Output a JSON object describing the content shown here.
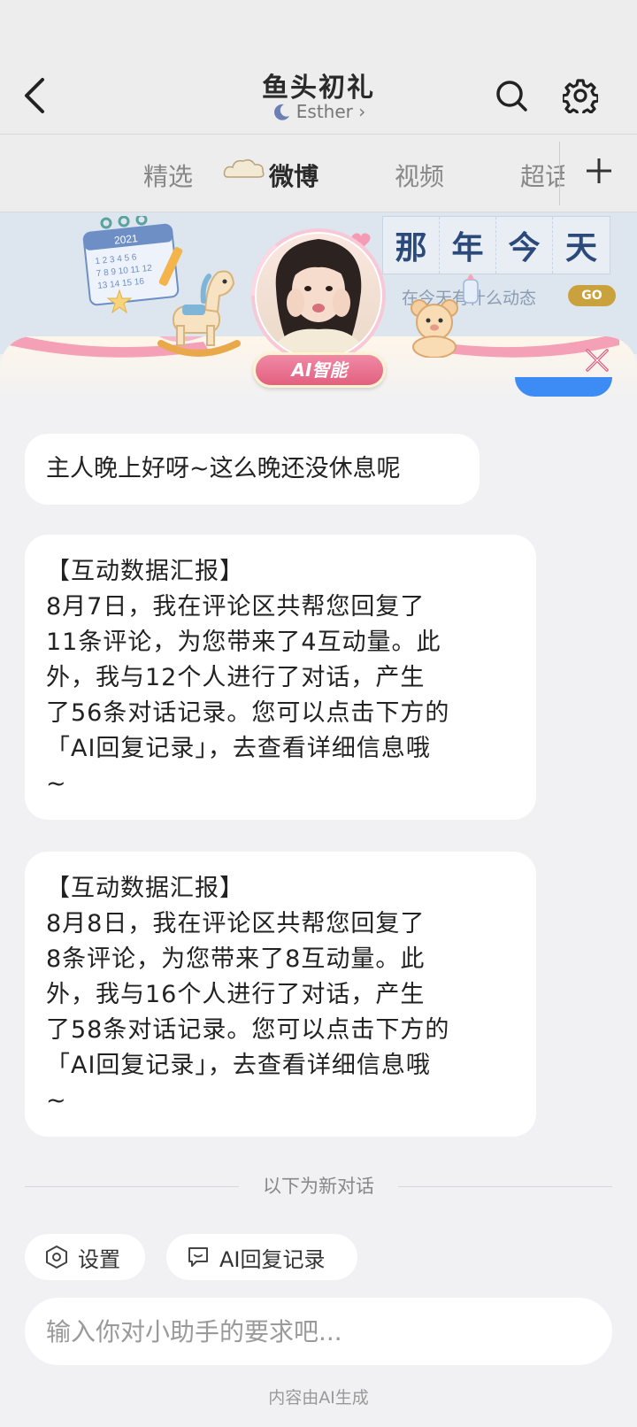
{
  "header": {
    "title": "鱼头初礼",
    "subtitle": "Esther",
    "subtitle_chevron": "›"
  },
  "tabs": [
    {
      "label": "精选",
      "active": false
    },
    {
      "label": "微博",
      "active": true
    },
    {
      "label": "视频",
      "active": false
    },
    {
      "label": "超话",
      "active": false
    }
  ],
  "banner": {
    "calendar_year": "2021",
    "nanian_chars": [
      "那",
      "年",
      "今",
      "天"
    ],
    "hint": "在今天有什么动态",
    "go_label": "GO"
  },
  "ai_badge": "AI智能",
  "messages": {
    "greeting": "主人晚上好呀~这么晚还没休息呢",
    "report1": [
      "【互动数据汇报】",
      "8月7日，我在评论区共帮您回复了",
      "11条评论，为您带来了4互动量。此",
      "外，我与12个人进行了对话，产生",
      "了56条对话记录。您可以点击下方的",
      "「AI回复记录」，去查看详细信息哦",
      "~"
    ],
    "report2": [
      "【互动数据汇报】",
      "8月8日，我在评论区共帮您回复了",
      "8条评论，为您带来了8互动量。此",
      "外，我与16个人进行了对话，产生",
      "了58条对话记录。您可以点击下方的",
      "「AI回复记录」，去查看详细信息哦",
      "~"
    ]
  },
  "divider_text": "以下为新对话",
  "chips": {
    "settings": "设置",
    "history": "AI回复记录"
  },
  "input": {
    "placeholder": "输入你对小助手的要求吧..."
  },
  "footnote": "内容由AI生成",
  "colors": {
    "accent_blue": "#3d8bf5",
    "badge_pink": "#e2607f",
    "go_gold": "#c9a23d",
    "page_bg": "#f1f1f3"
  },
  "icons": [
    "back-arrow-icon",
    "moon-icon",
    "search-icon",
    "gear-icon",
    "cloud-icon",
    "plus-icon",
    "close-icon",
    "hexagon-settings-icon",
    "chat-bubble-icon"
  ]
}
